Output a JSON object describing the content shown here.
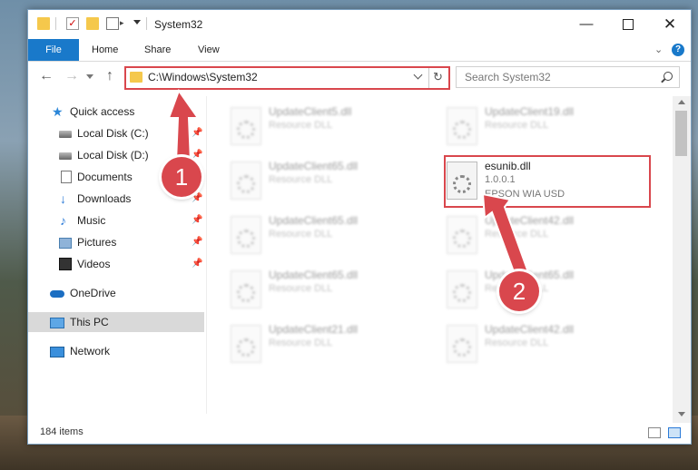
{
  "window": {
    "title": "System32",
    "min_glyph": "—",
    "close_glyph": "✕"
  },
  "quick_access_toolbar": {
    "check_glyph": "✓",
    "props_glyph": "▸"
  },
  "ribbon": {
    "tabs": [
      "File",
      "Home",
      "Share",
      "View"
    ],
    "chevron_glyph": "⌄",
    "help_glyph": "?"
  },
  "navbar": {
    "back_glyph": "←",
    "forward_glyph": "→",
    "up_glyph": "↑",
    "address": "C:\\Windows\\System32",
    "refresh_glyph": "↻",
    "search_placeholder": "Search System32"
  },
  "nav_pane": {
    "items": [
      {
        "label": "Quick access",
        "icon": "star-icon",
        "glyph": "★"
      },
      {
        "label": "Local Disk (C:)",
        "icon": "drive-icon",
        "pinned": true
      },
      {
        "label": "Local Disk (D:)",
        "icon": "drive-icon",
        "pinned": true
      },
      {
        "label": "Documents",
        "icon": "documents-icon",
        "pinned": true
      },
      {
        "label": "Downloads",
        "icon": "download-icon",
        "glyph": "↓",
        "pinned": true
      },
      {
        "label": "Music",
        "icon": "music-icon",
        "glyph": "♪",
        "pinned": true
      },
      {
        "label": "Pictures",
        "icon": "pictures-icon",
        "pinned": true
      },
      {
        "label": "Videos",
        "icon": "videos-icon",
        "pinned": true
      },
      {
        "label": "OneDrive",
        "icon": "cloud-icon"
      },
      {
        "label": "This PC",
        "icon": "computer-icon",
        "selected": true
      },
      {
        "label": "Network",
        "icon": "network-icon"
      }
    ],
    "pin_glyph": "📌"
  },
  "files": {
    "left_column": [
      {
        "name": "UpdateClient5.dll",
        "type": "Resource DLL"
      },
      {
        "name": "UpdateClient65.dll",
        "type": "Resource DLL"
      },
      {
        "name": "UpdateClient65.dll",
        "type": "Resource DLL"
      },
      {
        "name": "UpdateClient65.dll",
        "type": "Resource DLL"
      },
      {
        "name": "UpdateClient21.dll",
        "type": "Resource DLL"
      }
    ],
    "right_column": [
      {
        "name": "UpdateClient19.dll",
        "type": "Resource DLL"
      },
      {
        "name": "esunib.dll",
        "version": "1.0.0.1",
        "type": "EPSON WIA USD",
        "highlighted": true
      },
      {
        "name": "UpdateClient42.dll",
        "type": "Resource DLL"
      },
      {
        "name": "UpdateClient65.dll",
        "type": "Resource DLL"
      },
      {
        "name": "UpdateClient42.dll",
        "type": "Resource DLL"
      }
    ]
  },
  "status_bar": {
    "item_count": "184 items"
  },
  "annotations": {
    "callout_1": "1",
    "callout_2": "2",
    "color": "#d9474d"
  },
  "colors": {
    "accent": "#1979ca",
    "highlight_red": "#d9474d",
    "selection": "#d9d9d9"
  }
}
